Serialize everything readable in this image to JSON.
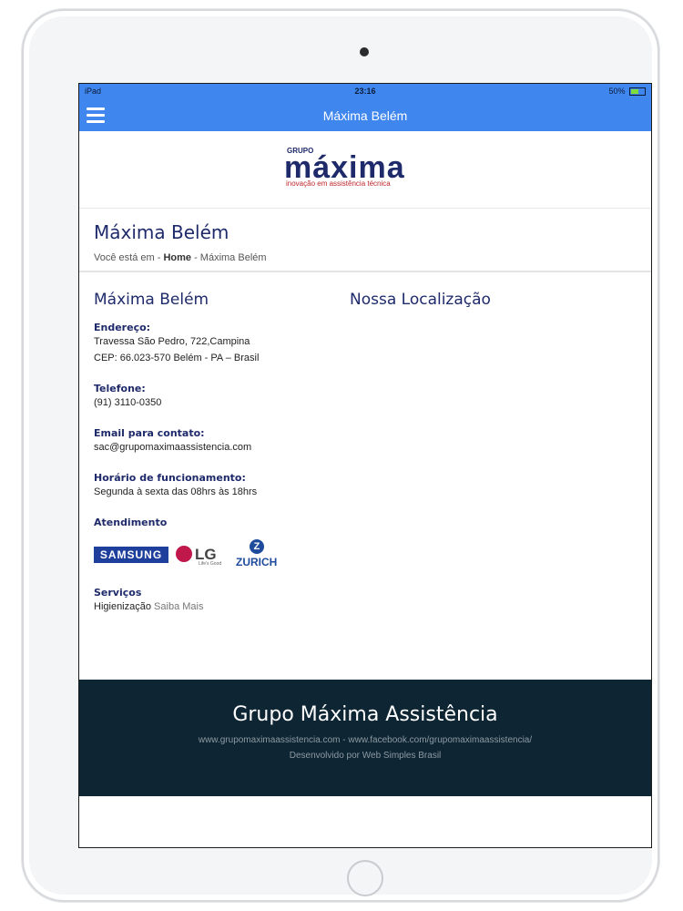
{
  "statusbar": {
    "device": "iPad",
    "time": "23:16",
    "battery": "50%"
  },
  "navbar": {
    "title": "Máxima Belém"
  },
  "logo": {
    "grupo": "GRUPO",
    "word": "máxima",
    "tagline": "inovação em assistência técnica"
  },
  "page": {
    "title": "Máxima Belém",
    "breadcrumb": {
      "prefix": "Você está em -",
      "home": "Home",
      "sep": "-",
      "current": "Máxima Belém"
    }
  },
  "left": {
    "heading": "Máxima Belém",
    "address_label": "Endereço:",
    "address_line1": "Travessa São Pedro, 722,Campina",
    "address_line2": "CEP: 66.023-570 Belém - PA – Brasil",
    "phone_label": "Telefone:",
    "phone": "(91) 3110-0350",
    "email_label": "Email para contato:",
    "email": "sac@grupomaximaassistencia.com",
    "hours_label": "Horário de funcionamento:",
    "hours": "Segunda à sexta das 08hrs às 18hrs",
    "service_label": "Atendimento",
    "brands": {
      "samsung": "SAMSUNG",
      "lg": "LG",
      "lg_tag": "Life's Good",
      "zurich": "ZURICH",
      "zurich_mark": "Z"
    },
    "services_label": "Serviços",
    "service_name": "Higienização",
    "service_link": "Saiba Mais"
  },
  "right": {
    "heading": "Nossa Localização"
  },
  "footer": {
    "title": "Grupo Máxima Assistência",
    "site": "www.grupomaximaassistencia.com",
    "sep": "-",
    "facebook": "www.facebook.com/grupomaximaassistencia/",
    "dev": "Desenvolvido por Web Simples Brasil"
  },
  "colors": {
    "nav": "#3f86ef",
    "brand": "#1e2a6a",
    "footer": "#0e2533",
    "accent_red": "#c0262d"
  }
}
